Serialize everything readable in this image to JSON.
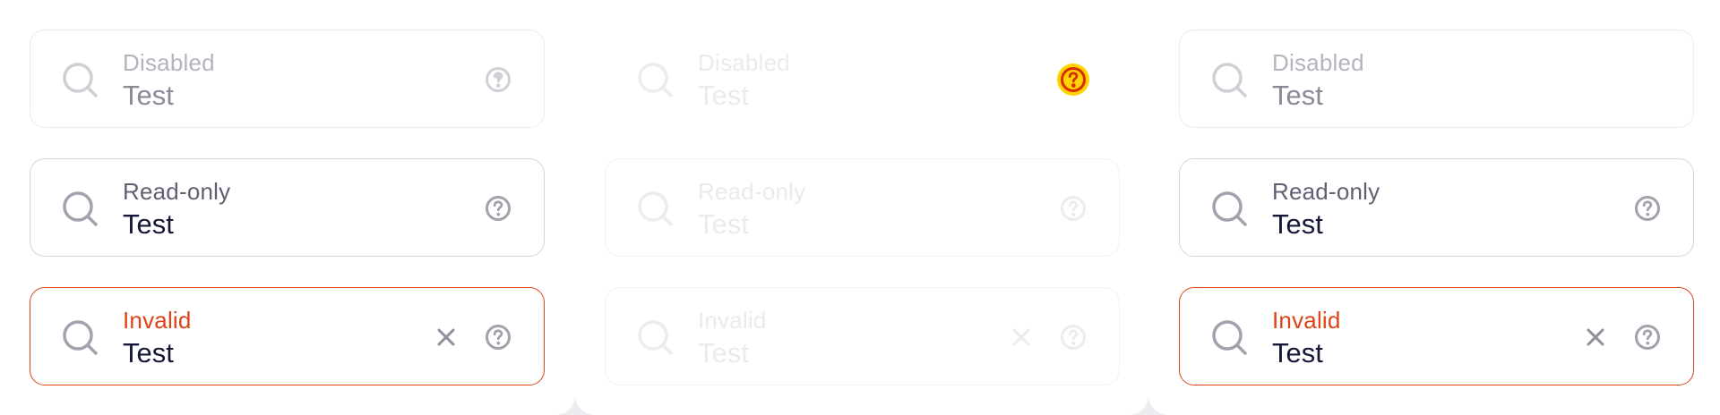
{
  "columns": [
    {
      "fields": [
        {
          "state": "disabled",
          "label": "Disabled",
          "value": "Test",
          "icon": "search-icon",
          "help_icon": "help-circle-icon"
        },
        {
          "state": "readonly",
          "label": "Read-only",
          "value": "Test",
          "icon": "search-icon",
          "help_icon": "help-circle-icon"
        },
        {
          "state": "invalid",
          "label": "Invalid",
          "value": "Test",
          "icon": "search-icon",
          "clear_icon": "close-icon",
          "help_icon": "help-circle-icon"
        }
      ]
    },
    {
      "fields": [
        {
          "state": "disabled",
          "label": "Disabled",
          "value": "Test",
          "icon": "search-icon",
          "help_icon": "help-circle-icon",
          "help_focused": true
        },
        {
          "state": "readonly",
          "label": "Read-only",
          "value": "Test",
          "icon": "search-icon",
          "help_icon": "help-circle-icon"
        },
        {
          "state": "invalid",
          "label": "Invalid",
          "value": "Test",
          "icon": "search-icon",
          "clear_icon": "close-icon",
          "help_icon": "help-circle-icon"
        }
      ]
    },
    {
      "fields": [
        {
          "state": "disabled",
          "label": "Disabled",
          "value": "Test",
          "icon": "search-icon",
          "help_icon": "help-circle-icon"
        },
        {
          "state": "readonly",
          "label": "Read-only",
          "value": "Test",
          "icon": "search-icon",
          "help_icon": "help-circle-icon"
        },
        {
          "state": "invalid",
          "label": "Invalid",
          "value": "Test",
          "icon": "search-icon",
          "clear_icon": "close-icon",
          "help_icon": "help-circle-icon"
        }
      ]
    }
  ],
  "colors": {
    "page_background": "#ececf0",
    "panel_background": "#ffffff",
    "border_default": "#d4d4dc",
    "invalid_accent": "#dd4316",
    "text_value": "#151736",
    "text_label": "#5f6074",
    "icon_gray": "#a2a2ae",
    "focus_ring": "#ffd400"
  }
}
